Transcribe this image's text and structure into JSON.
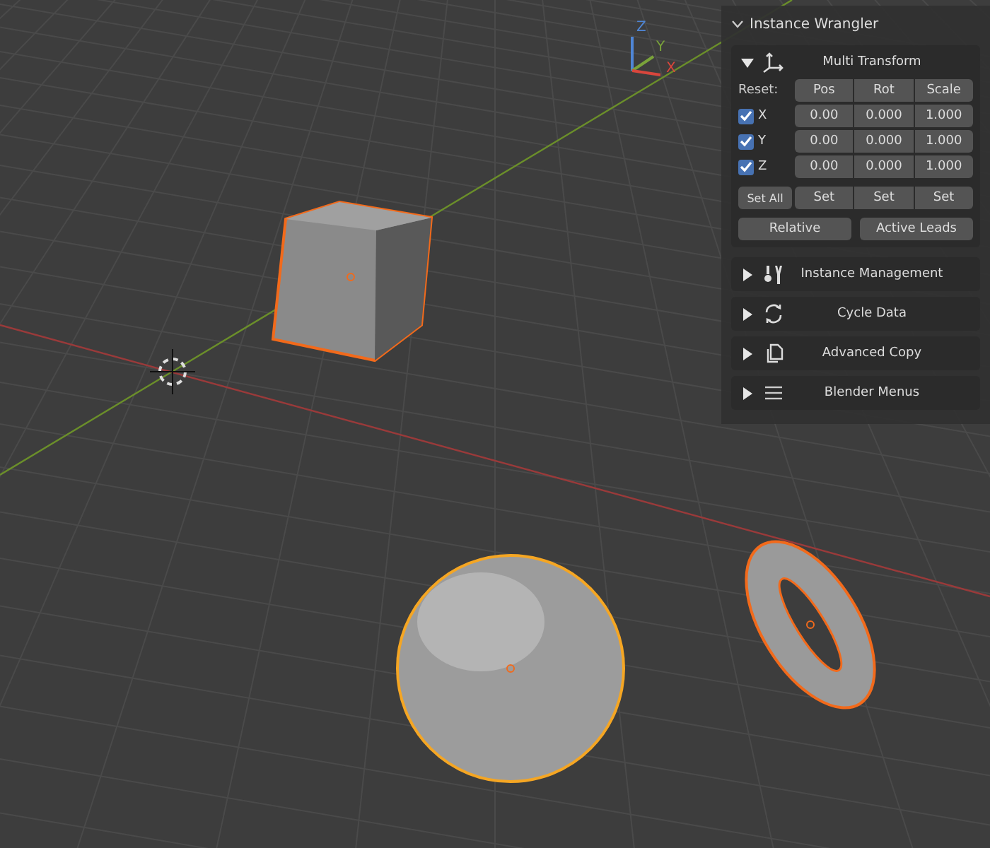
{
  "viewport": {
    "gizmo": [
      {
        "label": "Z",
        "color": "#4f86d6"
      },
      {
        "label": "Y",
        "color": "#7aa33a"
      },
      {
        "label": "X",
        "color": "#d9463c"
      }
    ]
  },
  "panel": {
    "title": "Instance Wrangler",
    "expanded": true,
    "transform": {
      "title": "Multi Transform",
      "expanded": true,
      "reset_label": "Reset:",
      "columns": [
        "Pos",
        "Rot",
        "Scale"
      ],
      "axes": [
        {
          "label": "X",
          "checked": true,
          "values": [
            "0.00",
            "0.000",
            "1.000"
          ]
        },
        {
          "label": "Y",
          "checked": true,
          "values": [
            "0.00",
            "0.000",
            "1.000"
          ]
        },
        {
          "label": "Z",
          "checked": true,
          "values": [
            "0.00",
            "0.000",
            "1.000"
          ]
        }
      ],
      "set_all": "Set All",
      "set_buttons": [
        "Set",
        "Set",
        "Set"
      ],
      "bottom_buttons": [
        "Relative",
        "Active Leads"
      ]
    },
    "sections": [
      {
        "title": "Instance Management",
        "expanded": false,
        "kind": "tools"
      },
      {
        "title": "Cycle Data",
        "expanded": false,
        "kind": "cycle"
      },
      {
        "title": "Advanced Copy",
        "expanded": false,
        "kind": "copy"
      },
      {
        "title": "Blender Menus",
        "expanded": false,
        "kind": "menu"
      }
    ]
  }
}
